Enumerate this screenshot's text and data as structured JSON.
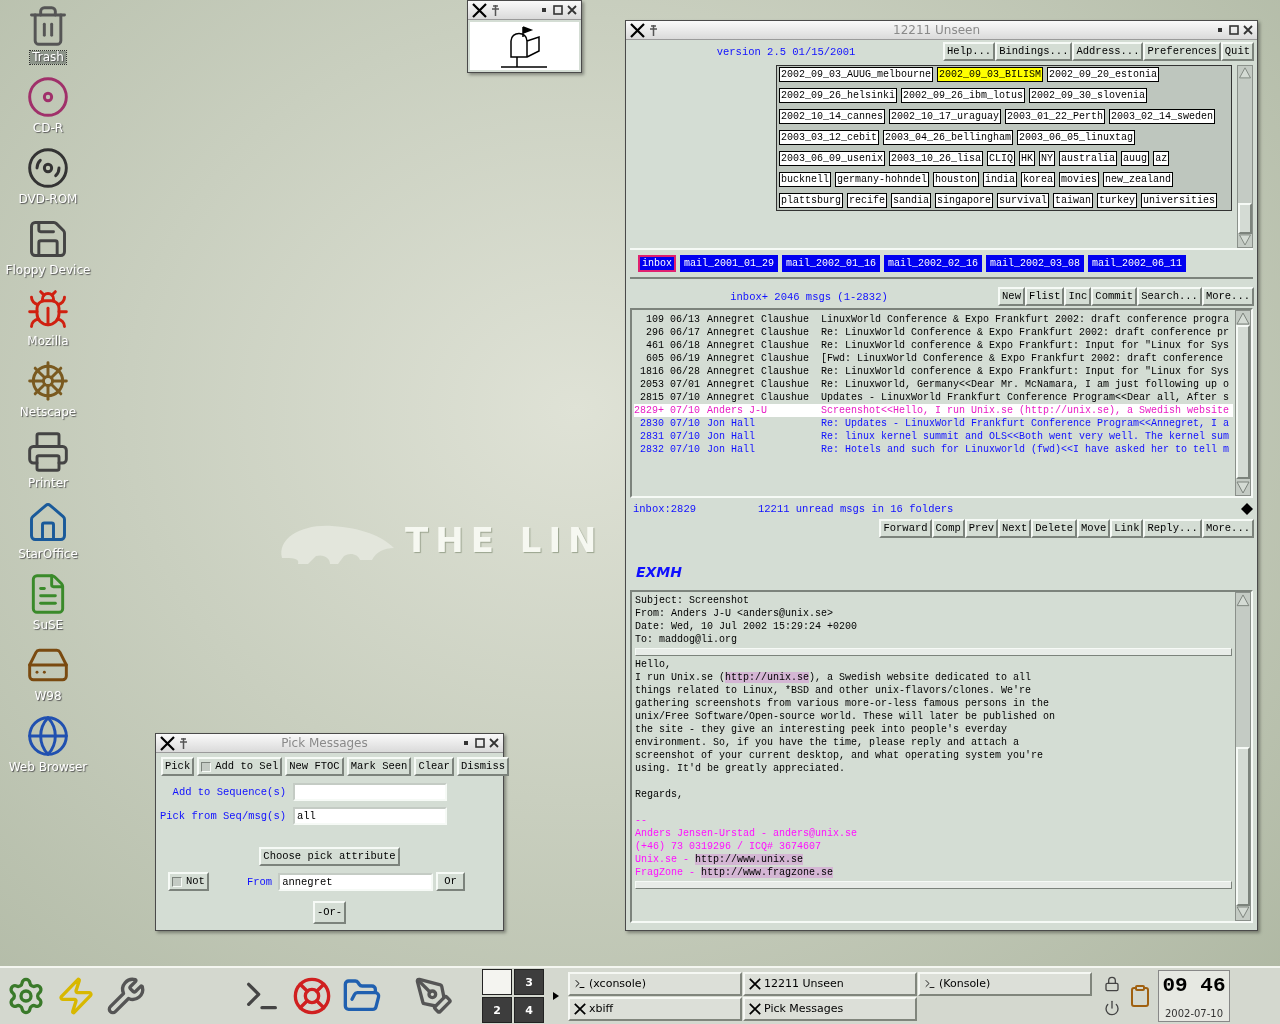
{
  "desktop_icons": [
    {
      "label": "Trash",
      "selected": true
    },
    {
      "label": "CD-R",
      "selected": false
    },
    {
      "label": "DVD-ROM",
      "selected": false
    },
    {
      "label": "Floppy Device",
      "selected": false
    },
    {
      "label": "Mozilla",
      "selected": false
    },
    {
      "label": "Netscape",
      "selected": false
    },
    {
      "label": "Printer",
      "selected": false
    },
    {
      "label": "StarOffice",
      "selected": false
    },
    {
      "label": "SuSE",
      "selected": false
    },
    {
      "label": "W98",
      "selected": false
    },
    {
      "label": "Web Browser",
      "selected": false
    }
  ],
  "wallpaper_text": "THE LIN",
  "exmh": {
    "title": "12211 Unseen",
    "version": "version 2.5 01/15/2001",
    "top_buttons": [
      "Help...",
      "Bindings...",
      "Address...",
      "Preferences",
      "Quit"
    ],
    "folder_rows": [
      [
        {
          "label": "2002_09_03_AUUG_melbourne",
          "unseen": false
        },
        {
          "label": "2002_09_03_BILISM",
          "unseen": true
        },
        {
          "label": "2002_09_20_estonia",
          "unseen": false
        }
      ],
      [
        {
          "label": "2002_09_26_helsinki",
          "unseen": false
        },
        {
          "label": "2002_09_26_ibm_lotus",
          "unseen": false
        },
        {
          "label": "2002_09_30_slovenia",
          "unseen": false
        }
      ],
      [
        {
          "label": "2002_10_14_cannes",
          "unseen": false
        },
        {
          "label": "2002_10_17_uraguay",
          "unseen": false
        },
        {
          "label": "2003_01_22_Perth",
          "unseen": false
        },
        {
          "label": "2003_02_14_sweden",
          "unseen": false
        }
      ],
      [
        {
          "label": "2003_03_12_cebit",
          "unseen": false
        },
        {
          "label": "2003_04_26_bellingham",
          "unseen": false
        },
        {
          "label": "2003_06_05_linuxtag",
          "unseen": false
        }
      ],
      [
        {
          "label": "2003_06_09_usenix",
          "unseen": false
        },
        {
          "label": "2003_10_26_lisa",
          "unseen": false
        },
        {
          "label": "CLIQ",
          "unseen": false
        },
        {
          "label": "HK",
          "unseen": false
        },
        {
          "label": "NY",
          "unseen": false
        },
        {
          "label": "australia",
          "unseen": false
        },
        {
          "label": "auug",
          "unseen": false
        },
        {
          "label": "az",
          "unseen": false
        }
      ],
      [
        {
          "label": "bucknell",
          "unseen": false
        },
        {
          "label": "germany-hohndel",
          "unseen": false
        },
        {
          "label": "houston",
          "unseen": false
        },
        {
          "label": "india",
          "unseen": false
        },
        {
          "label": "korea",
          "unseen": false
        },
        {
          "label": "movies",
          "unseen": false
        },
        {
          "label": "new_zealand",
          "unseen": false
        }
      ],
      [
        {
          "label": "plattsburg",
          "unseen": false
        },
        {
          "label": "recife",
          "unseen": false
        },
        {
          "label": "sandia",
          "unseen": false
        },
        {
          "label": "singapore",
          "unseen": false
        },
        {
          "label": "survival",
          "unseen": false
        },
        {
          "label": "taiwan",
          "unseen": false
        },
        {
          "label": "turkey",
          "unseen": false
        },
        {
          "label": "universities",
          "unseen": false
        }
      ]
    ],
    "subfolders": [
      {
        "label": "inbox",
        "current": true
      },
      {
        "label": "mail_2001_01_29",
        "current": false
      },
      {
        "label": "mail_2002_01_16",
        "current": false
      },
      {
        "label": "mail_2002_02_16",
        "current": false
      },
      {
        "label": "mail_2002_03_08",
        "current": false
      },
      {
        "label": "mail_2002_06_11",
        "current": false
      }
    ],
    "toc_summary": "inbox+ 2046 msgs (1-2832)",
    "toc_buttons": [
      "New",
      "Flist",
      "Inc",
      "Commit",
      "Search...",
      "More..."
    ],
    "messages": [
      {
        "number": "109",
        "date": "06/13",
        "from": "Annegret Claushue",
        "subject": "LinuxWorld Conference & Expo Frankfurt 2002: draft conference progra",
        "kind": "read"
      },
      {
        "number": "296",
        "date": "06/17",
        "from": "Annegret Claushue",
        "subject": "Re: LinuxWorld Conference & Expo Frankfurt 2002: draft conference pr",
        "kind": "read"
      },
      {
        "number": "461",
        "date": "06/18",
        "from": "Annegret Claushue",
        "subject": "Re: LinuxWorld conference & Expo Frankfurt: Input for \"Linux for Sys",
        "kind": "read"
      },
      {
        "number": "605",
        "date": "06/19",
        "from": "Annegret Claushue",
        "subject": "[Fwd: LinuxWorld Conference & Expo Frankfurt 2002: draft conference",
        "kind": "read"
      },
      {
        "number": "1816",
        "date": "06/28",
        "from": "Annegret Claushue",
        "subject": "Re: LinuxWorld conference & Expo Frankfurt: Input for \"Linux for Sys",
        "kind": "read"
      },
      {
        "number": "2053",
        "date": "07/01",
        "from": "Annegret Claushue",
        "subject": "Re: Linuxworld, Germany<<Dear Mr. McNamara, I am just following up o",
        "kind": "read"
      },
      {
        "number": "2815",
        "date": "07/10",
        "from": "Annegret Claushue",
        "subject": "Updates - LinuxWorld Frankfurt Conference Program<<Dear all, After s",
        "kind": "read"
      },
      {
        "number": "2829+",
        "date": "07/10",
        "from": "Anders J-U",
        "subject": "Screenshot<<Hello, I run Unix.se (http://unix.se), a Swedish website",
        "kind": "current"
      },
      {
        "number": "2830",
        "date": "07/10",
        "from": "Jon Hall",
        "subject": "Re: Updates - LinuxWorld Frankfurt Conference Program<<Annegret, I a",
        "kind": "unseen"
      },
      {
        "number": "2831",
        "date": "07/10",
        "from": "Jon Hall",
        "subject": "Re: linux kernel summit and OLS<<Both went very well. The kernel sum",
        "kind": "unseen"
      },
      {
        "number": "2832",
        "date": "07/10",
        "from": "Jon Hall",
        "subject": "Re: Hotels and such for Linuxworld (fwd)<<I have asked her to tell m",
        "kind": "unseen"
      }
    ],
    "status_folder": "inbox:2829",
    "status_unread": "12211 unread msgs in 16 folders",
    "message_buttons": [
      "Forward",
      "Comp",
      "Prev",
      "Next",
      "Delete",
      "Move",
      "Link",
      "Reply...",
      "More..."
    ],
    "logo": "EXMH",
    "headers": [
      "Subject: Screenshot",
      "From: Anders J-U <anders@unix.se>",
      "Date: Wed, 10 Jul 2002 15:29:24 +0200",
      "To: maddog@li.org"
    ],
    "body_paragraphs": [
      [
        {
          "parts": [
            {
              "text": "Hello,"
            }
          ]
        },
        {
          "parts": [
            {
              "text": "I run Unix.se ("
            },
            {
              "text": "http://unix.se",
              "link": true
            },
            {
              "text": "), a Swedish website dedicated to all"
            }
          ]
        },
        {
          "parts": [
            {
              "text": "things related to Linux, *BSD and other unix-flavors/clones. We're"
            }
          ]
        },
        {
          "parts": [
            {
              "text": "gathering screenshots from various more-or-less famous persons in the"
            }
          ]
        },
        {
          "parts": [
            {
              "text": "unix/Free Software/Open-source world. These will later be published on"
            }
          ]
        },
        {
          "parts": [
            {
              "text": "the site - they give an interesting peek into people's everday"
            }
          ]
        },
        {
          "parts": [
            {
              "text": "environment. So, if you have the time, please reply and attach a"
            }
          ]
        },
        {
          "parts": [
            {
              "text": "screenshot of your current desktop, and what operating system you're"
            }
          ]
        },
        {
          "parts": [
            {
              "text": "using. It'd be greatly appreciated."
            }
          ]
        }
      ],
      [
        {
          "parts": [
            {
              "text": "Regards,"
            }
          ]
        }
      ]
    ],
    "signature": [
      {
        "parts": [
          {
            "text": "--"
          }
        ]
      },
      {
        "parts": [
          {
            "text": "Anders Jensen-Urstad - anders@unix.se"
          }
        ]
      },
      {
        "parts": [
          {
            "text": "(+46) 73 0319296 / ICQ# 3674607"
          }
        ]
      },
      {
        "parts": [
          {
            "text": "Unix.se - "
          },
          {
            "text": "http://www.unix.se",
            "link": true
          }
        ]
      },
      {
        "parts": [
          {
            "text": "FragZone - "
          },
          {
            "text": "http://www.fragzone.se",
            "link": true
          }
        ]
      }
    ]
  },
  "pick": {
    "title": "Pick Messages",
    "buttons": [
      {
        "label": "Pick",
        "kind": "button"
      },
      {
        "label": "Add to Sel",
        "kind": "check",
        "checked": false
      },
      {
        "label": "New FTOC",
        "kind": "button"
      },
      {
        "label": "Mark Seen",
        "kind": "button"
      },
      {
        "label": "Clear",
        "kind": "button"
      },
      {
        "label": "Dismiss",
        "kind": "button"
      }
    ],
    "fields": [
      {
        "label": "Add to Sequence(s)"
      },
      {
        "label": "Pick from Seq/msg(s)",
        "value": "all"
      }
    ],
    "choose_button": "Choose pick attribute",
    "not_toggle": {
      "label": "Not",
      "checked": false
    },
    "attribute_label": "From",
    "attribute_value": "annegret",
    "or_button": "Or",
    "or_group_button": "-Or-"
  },
  "taskbar": {
    "pager": [
      {
        "selected": true
      },
      {
        "label": "3",
        "selected": false
      },
      {
        "label": "2",
        "selected": false
      },
      {
        "label": "4",
        "selected": false
      }
    ],
    "tasks": [
      {
        "label": "(xconsole)",
        "kind": "console"
      },
      {
        "label": "12211 Unseen",
        "kind": "x"
      },
      {
        "label": "(Konsole)",
        "kind": "konsole"
      },
      {
        "label": "xbiff",
        "kind": "x"
      },
      {
        "label": "Pick Messages",
        "kind": "x"
      }
    ],
    "clock": "09 46",
    "date": "2002-07-10"
  }
}
